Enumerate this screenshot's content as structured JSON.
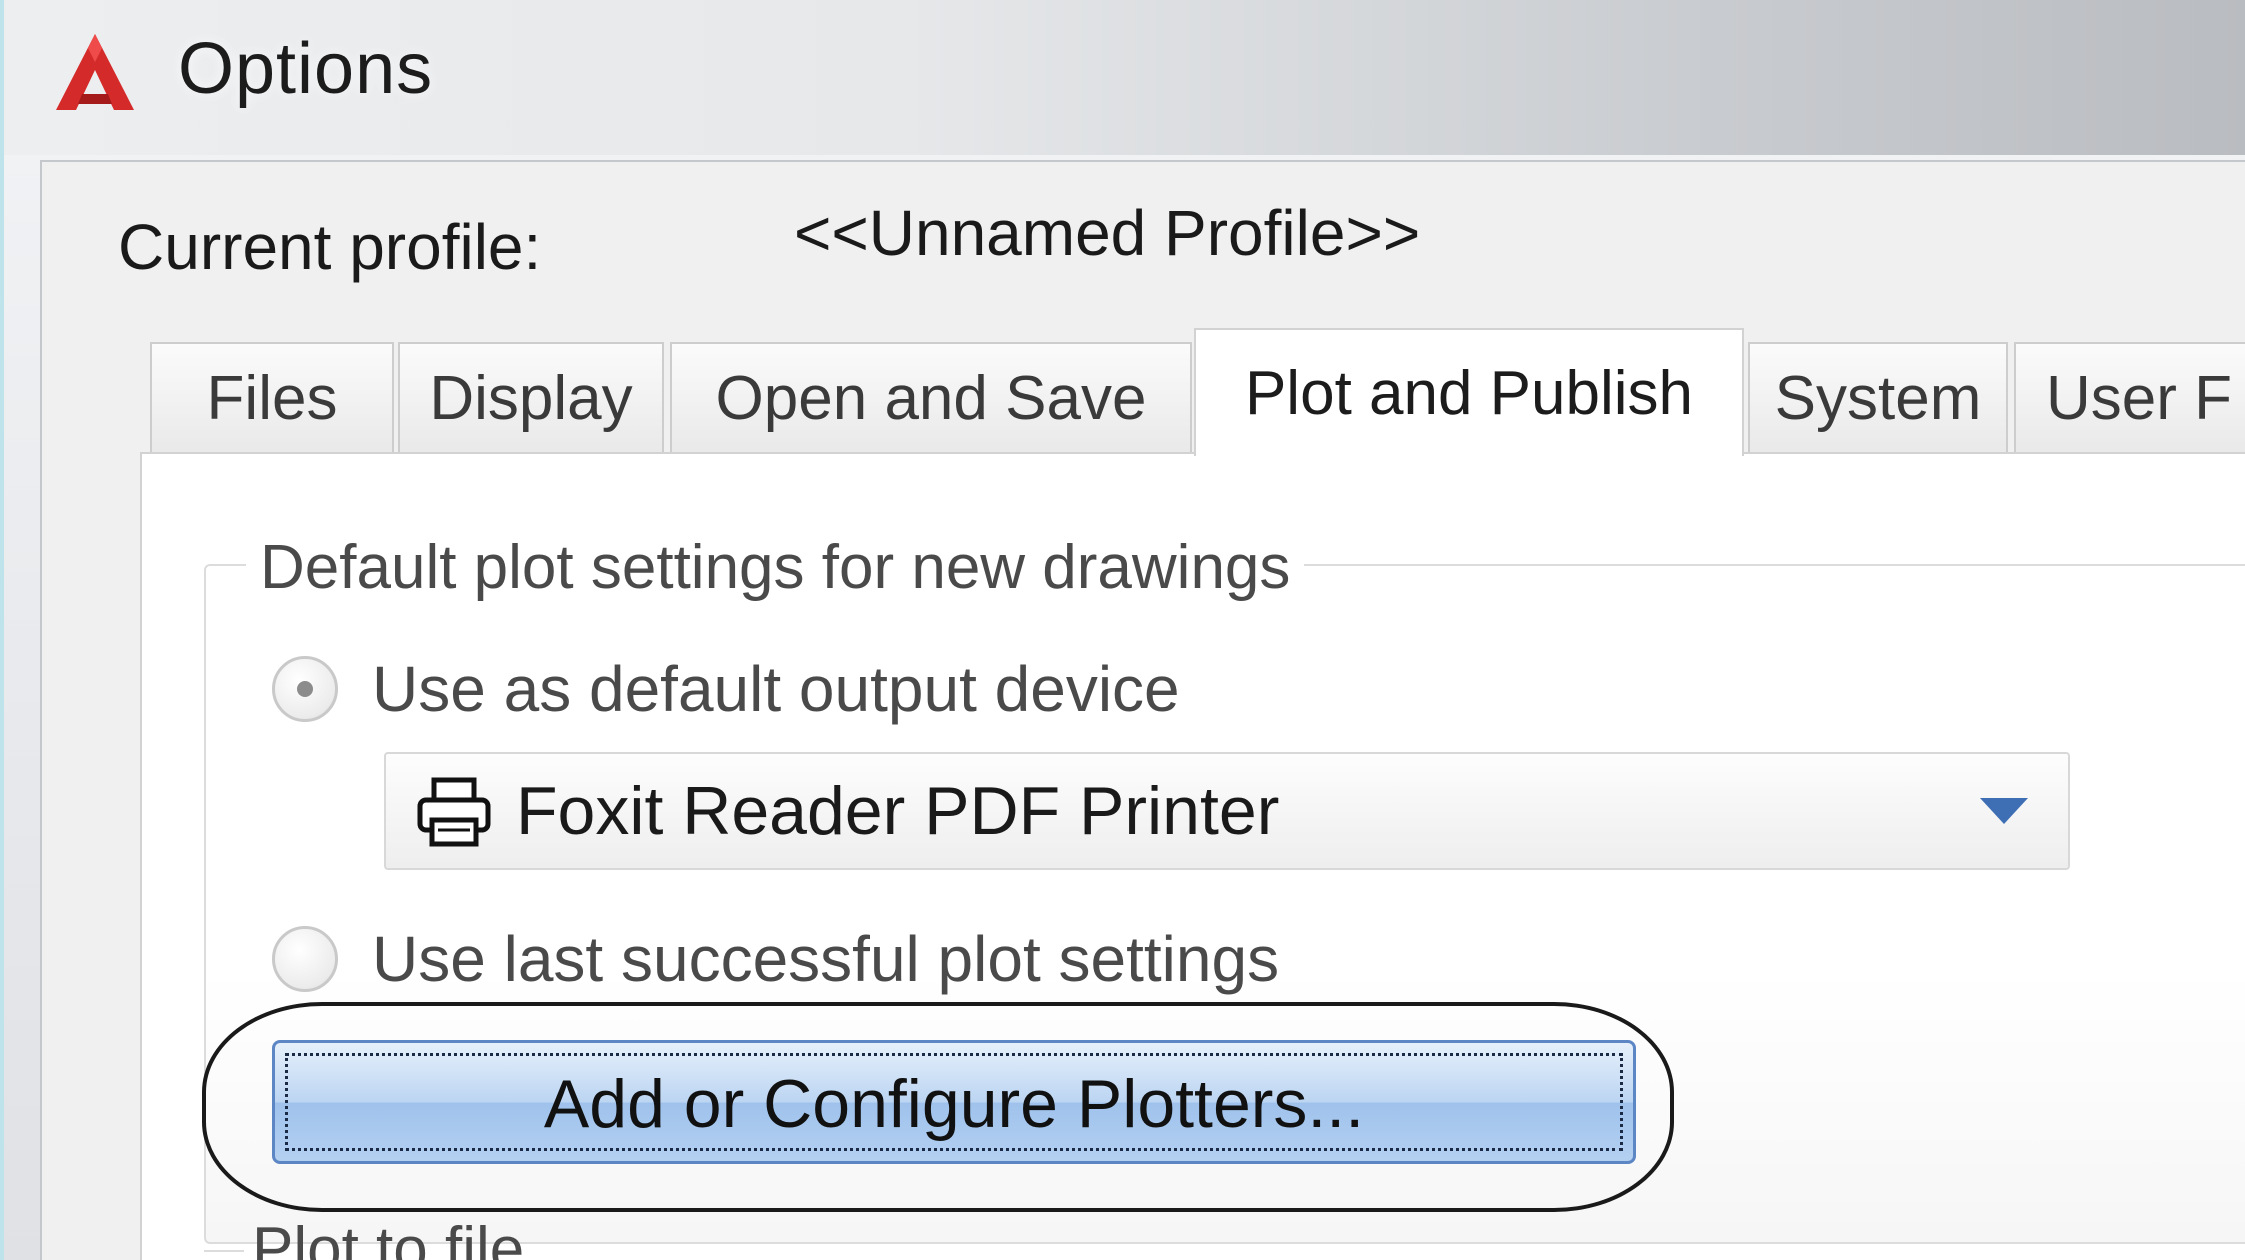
{
  "window": {
    "title": "Options"
  },
  "profile": {
    "label": "Current profile:",
    "value": "<<Unnamed Profile>>"
  },
  "tabs": [
    {
      "label": "Files"
    },
    {
      "label": "Display"
    },
    {
      "label": "Open and Save"
    },
    {
      "label": "Plot and Publish",
      "active": true
    },
    {
      "label": "System"
    },
    {
      "label": "User F"
    }
  ],
  "plot_settings": {
    "group_title": "Default plot settings for new drawings",
    "option_default_device": "Use as default output device",
    "device_selected": "Foxit Reader PDF Printer",
    "option_last_settings": "Use last successful plot settings",
    "add_configure_button": "Add or Configure Plotters...",
    "next_group_title": "Plot to file"
  },
  "colors": {
    "logo_red": "#d42a2a",
    "button_blue": "#9fc2ec",
    "dropdown_arrow": "#3e6fb4"
  },
  "icons": {
    "app": "autocad-logo-icon",
    "device": "printer-icon",
    "dropdown": "chevron-down-icon"
  }
}
